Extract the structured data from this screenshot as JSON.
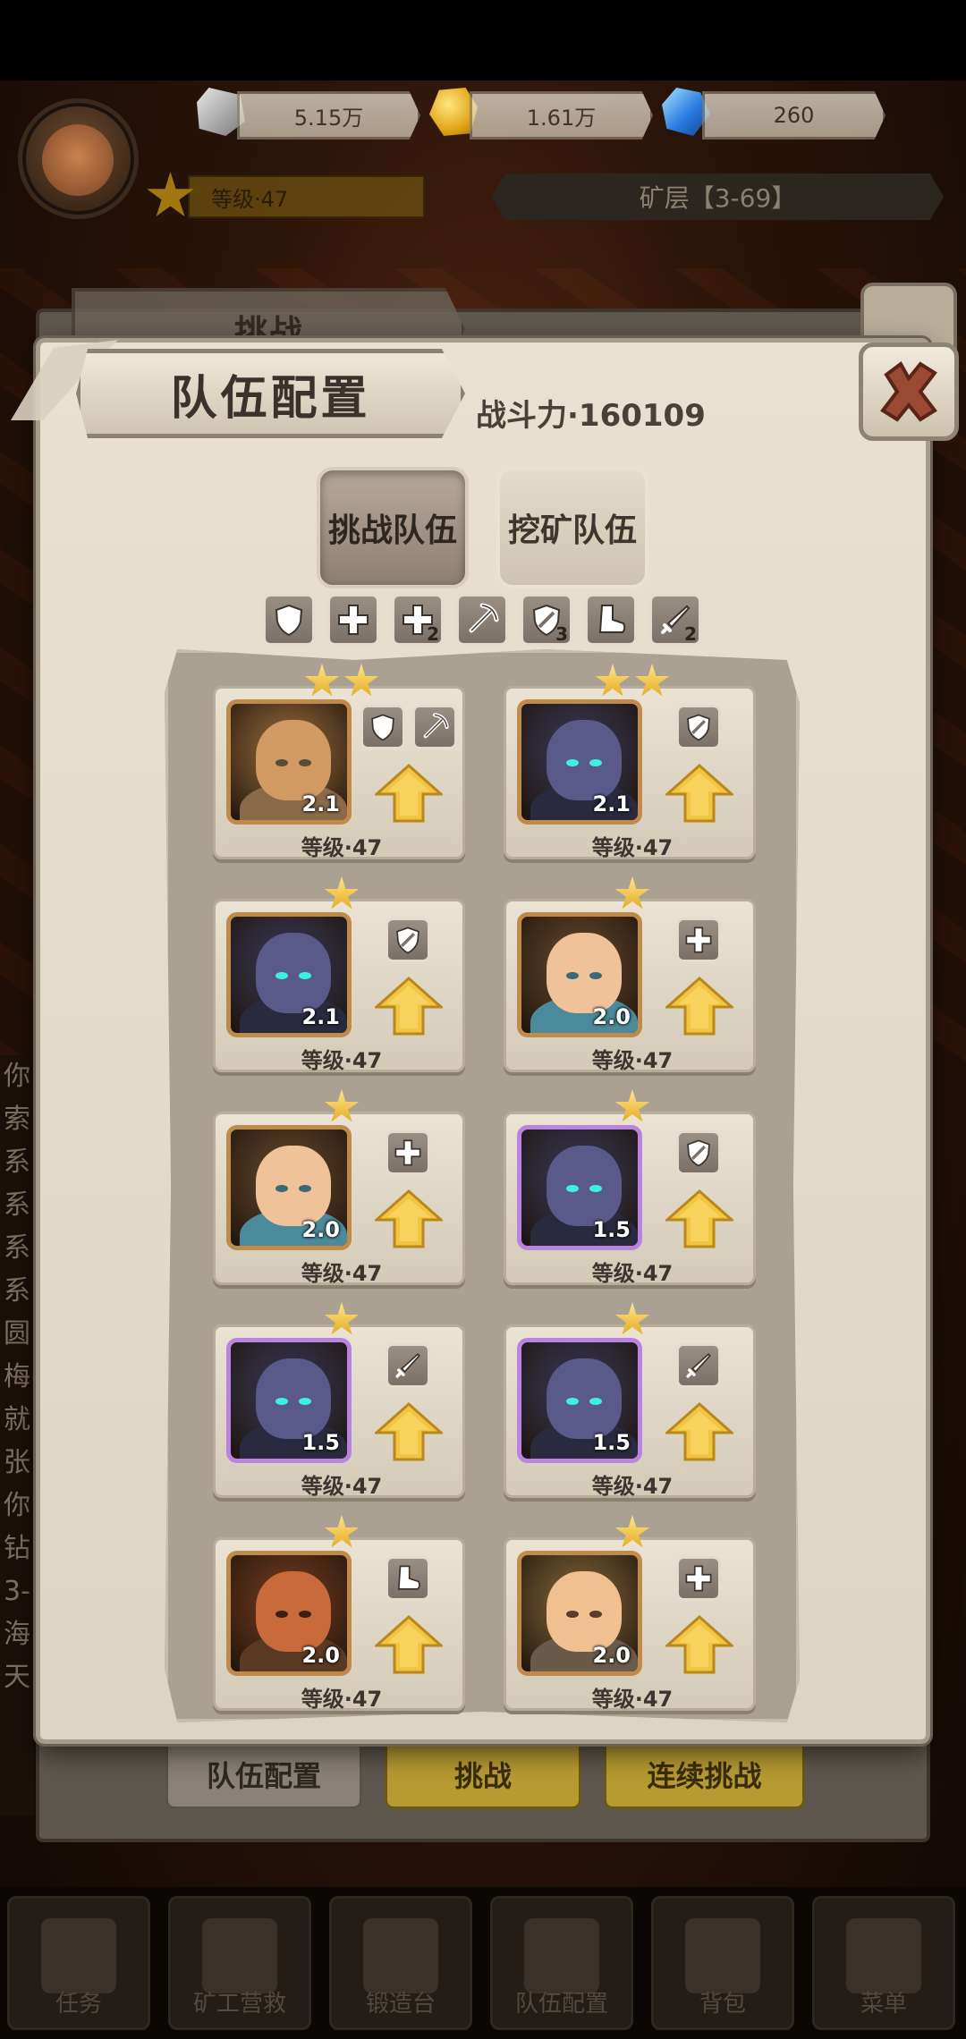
{
  "resources": {
    "stone": "5.15万",
    "gold": "1.61万",
    "diamond": "260"
  },
  "player": {
    "level": "等级·47"
  },
  "mine": {
    "layer": "矿层【3-69】"
  },
  "background": {
    "tab_label": "挑战",
    "buttons": [
      "队伍配置",
      "挑战",
      "连续挑战"
    ],
    "nav": [
      "任务",
      "矿工营救",
      "锻造台",
      "队伍配置",
      "背包",
      "菜单"
    ],
    "side_text": [
      "你",
      "索",
      "系",
      "系",
      "系",
      "系",
      "圆",
      "梅",
      "就",
      "张",
      "你",
      "钻",
      "3-",
      "海",
      "天"
    ]
  },
  "dialog": {
    "title": "队伍配置",
    "power": "战斗力·160109",
    "tabs": [
      "挑战队伍",
      "挖矿队伍"
    ],
    "active_tab": "挑战队伍"
  },
  "team_skills": [
    {
      "icon": "shield-icon",
      "count": ""
    },
    {
      "icon": "heal-cross-icon",
      "count": ""
    },
    {
      "icon": "heal-cross-icon",
      "count": "2"
    },
    {
      "icon": "pickaxe-icon",
      "count": ""
    },
    {
      "icon": "shield-strike-icon",
      "count": "3"
    },
    {
      "icon": "boot-icon",
      "count": ""
    },
    {
      "icon": "sword-icon",
      "count": "2"
    }
  ],
  "heroes": [
    {
      "stars": 2,
      "rank": "2.1",
      "level": "等级·47",
      "frame": "gold",
      "portrait": "steampunk-robot",
      "skills": [
        "shield-icon",
        "pickaxe-icon"
      ]
    },
    {
      "stars": 2,
      "rank": "2.1",
      "level": "等级·47",
      "frame": "gold",
      "portrait": "hooded-reaper",
      "skills": [
        "shield-strike-icon"
      ]
    },
    {
      "stars": 1,
      "rank": "2.1",
      "level": "等级·47",
      "frame": "gold",
      "portrait": "hooded-reaper",
      "skills": [
        "shield-strike-icon"
      ]
    },
    {
      "stars": 1,
      "rank": "2.0",
      "level": "等级·47",
      "frame": "gold",
      "portrait": "healer-girl",
      "skills": [
        "heal-cross-icon"
      ]
    },
    {
      "stars": 1,
      "rank": "2.0",
      "level": "等级·47",
      "frame": "gold",
      "portrait": "healer-girl",
      "skills": [
        "heal-cross-icon"
      ]
    },
    {
      "stars": 1,
      "rank": "1.5",
      "level": "等级·47",
      "frame": "purple",
      "portrait": "hooded-reaper",
      "skills": [
        "shield-strike-icon"
      ]
    },
    {
      "stars": 1,
      "rank": "1.5",
      "level": "等级·47",
      "frame": "purple",
      "portrait": "hooded-reaper",
      "skills": [
        "sword-icon"
      ]
    },
    {
      "stars": 1,
      "rank": "1.5",
      "level": "等级·47",
      "frame": "purple",
      "portrait": "hooded-reaper",
      "skills": [
        "sword-icon"
      ]
    },
    {
      "stars": 1,
      "rank": "2.0",
      "level": "等级·47",
      "frame": "gold",
      "portrait": "dwarf-warrior",
      "skills": [
        "boot-icon"
      ]
    },
    {
      "stars": 1,
      "rank": "2.0",
      "level": "等级·47",
      "frame": "gold",
      "portrait": "goggle-girl",
      "skills": [
        "heal-cross-icon"
      ]
    }
  ],
  "colors": {
    "panel": "#e3dccd",
    "star": "#f5c73a",
    "arrow": "#f2c443",
    "frame_gold": "#c08a4a",
    "frame_purple": "#b884e0",
    "close_x": "#9a4a32"
  }
}
